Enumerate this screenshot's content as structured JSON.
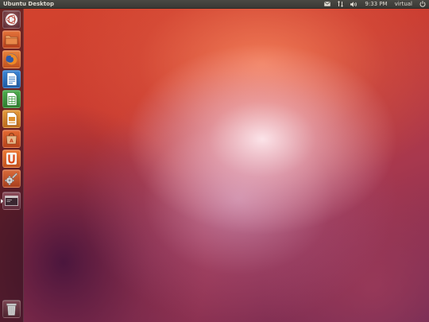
{
  "top_panel": {
    "title": "Ubuntu Desktop",
    "indicators": {
      "messaging": "envelope-icon",
      "network": "network-arrows-icon",
      "sound": "speaker-icon",
      "clock": "9:33 PM",
      "user": "virtual",
      "session": "power-icon"
    }
  },
  "launcher": {
    "items": [
      {
        "icon": "dash-home-icon",
        "color": "#e5e5e5"
      },
      {
        "icon": "files-folder-icon",
        "color": "#d45d2b"
      },
      {
        "icon": "firefox-icon",
        "color": "#e8752a"
      },
      {
        "icon": "libreoffice-writer-icon",
        "color": "#2f73c0"
      },
      {
        "icon": "libreoffice-calc-icon",
        "color": "#3f9b3f"
      },
      {
        "icon": "libreoffice-impress-icon",
        "color": "#d9892b"
      },
      {
        "icon": "software-center-icon",
        "color": "#d9572a"
      },
      {
        "icon": "ubuntu-one-icon",
        "color": "#e06a2a"
      },
      {
        "icon": "system-settings-icon",
        "color": "#c9542b"
      },
      {
        "icon": "workspace-switcher-icon",
        "color": "#7a3d4a"
      },
      {
        "icon": "trash-icon",
        "color": "#6a3a44"
      }
    ]
  },
  "colors": {
    "panel_bg": "#3c3b37",
    "panel_text": "#dfdbd2",
    "wallpaper_orange": "#d4442e",
    "wallpaper_purple": "#6e2a55"
  }
}
